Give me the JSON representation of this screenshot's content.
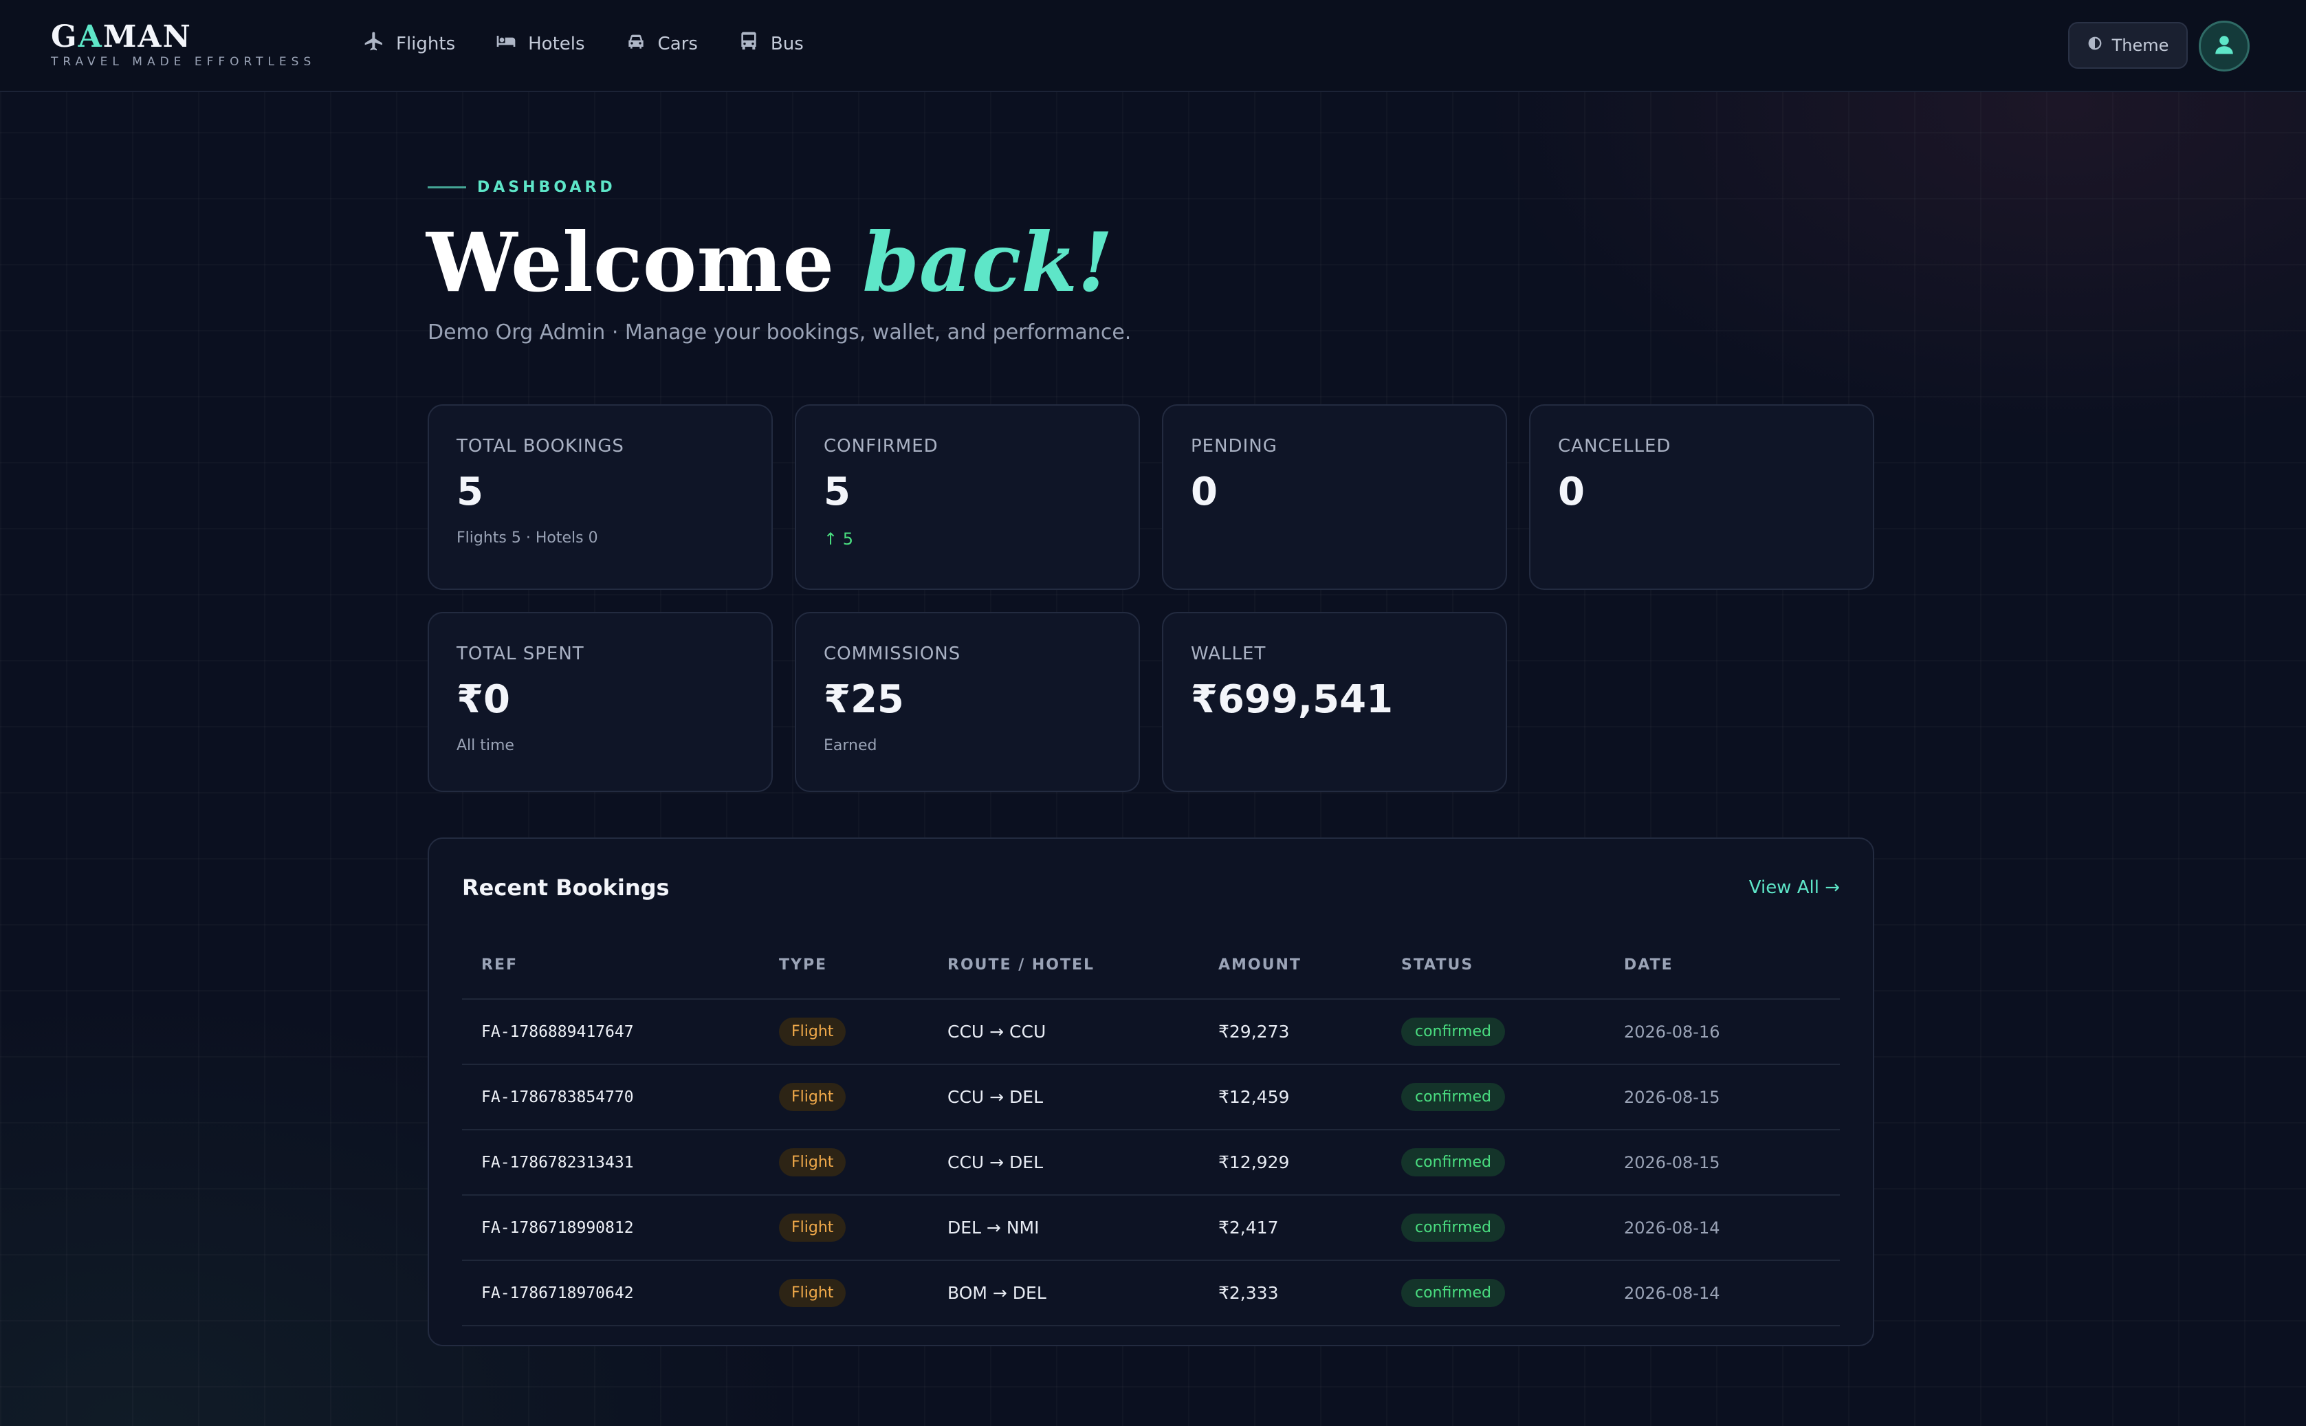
{
  "brand": {
    "name_prefix": "G",
    "name_accent": "A",
    "name_suffix": "MAN",
    "tagline": "TRAVEL MADE EFFORTLESS"
  },
  "nav": {
    "items": [
      {
        "label": "Flights",
        "icon": "plane-icon"
      },
      {
        "label": "Hotels",
        "icon": "bed-icon"
      },
      {
        "label": "Cars",
        "icon": "car-icon"
      },
      {
        "label": "Bus",
        "icon": "bus-icon"
      }
    ]
  },
  "header": {
    "theme_label": "Theme",
    "theme_icon": "half-circle-icon",
    "avatar_icon": "user-icon"
  },
  "hero": {
    "eyebrow": "DASHBOARD",
    "title_main": "Welcome ",
    "title_accent": "back!",
    "subtitle": "Demo Org Admin · Manage your bookings, wallet, and performance."
  },
  "stats": {
    "total_bookings": {
      "label": "TOTAL BOOKINGS",
      "value": "5",
      "sub": "Flights 5 · Hotels 0"
    },
    "confirmed": {
      "label": "CONFIRMED",
      "value": "5",
      "sub": "↑ 5"
    },
    "pending": {
      "label": "PENDING",
      "value": "0"
    },
    "cancelled": {
      "label": "CANCELLED",
      "value": "0"
    },
    "total_spent": {
      "label": "TOTAL SPENT",
      "value": "₹0",
      "sub": "All time"
    },
    "commissions": {
      "label": "COMMISSIONS",
      "value": "₹25",
      "sub": "Earned"
    },
    "wallet": {
      "label": "WALLET",
      "value": "₹699,541"
    }
  },
  "recent": {
    "title": "Recent Bookings",
    "view_all": "View All →",
    "columns": [
      "REF",
      "TYPE",
      "ROUTE / HOTEL",
      "AMOUNT",
      "STATUS",
      "DATE"
    ],
    "rows": [
      {
        "ref": "FA-1786889417647",
        "type": "Flight",
        "route": "CCU → CCU",
        "amount": "₹29,273",
        "status": "confirmed",
        "date": "2026-08-16"
      },
      {
        "ref": "FA-1786783854770",
        "type": "Flight",
        "route": "CCU → DEL",
        "amount": "₹12,459",
        "status": "confirmed",
        "date": "2026-08-15"
      },
      {
        "ref": "FA-1786782313431",
        "type": "Flight",
        "route": "CCU → DEL",
        "amount": "₹12,929",
        "status": "confirmed",
        "date": "2026-08-15"
      },
      {
        "ref": "FA-1786718990812",
        "type": "Flight",
        "route": "DEL → NMI",
        "amount": "₹2,417",
        "status": "confirmed",
        "date": "2026-08-14"
      },
      {
        "ref": "FA-1786718970642",
        "type": "Flight",
        "route": "BOM → DEL",
        "amount": "₹2,333",
        "status": "confirmed",
        "date": "2026-08-14"
      }
    ]
  },
  "colors": {
    "accent": "#5ee6c8",
    "background": "#0b1020",
    "card": "#0f1527",
    "success": "#4ade80",
    "warning": "#f0a94a"
  }
}
